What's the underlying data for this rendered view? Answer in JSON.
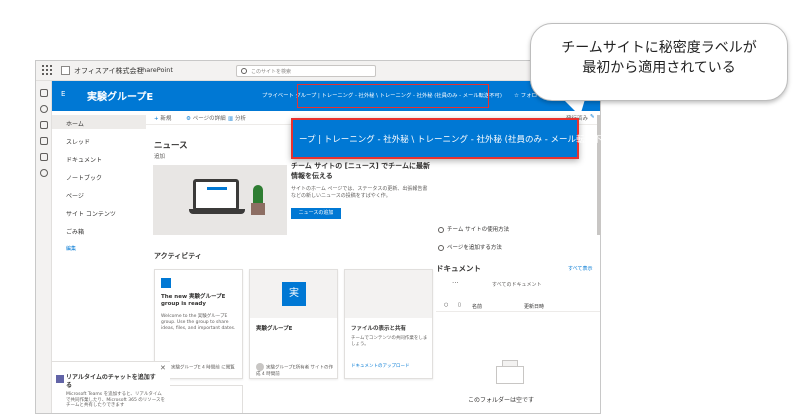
{
  "topbar": {
    "org": "オフィスアイ株式会社",
    "product": "SharePoint",
    "search_placeholder": "このサイトを検索"
  },
  "site": {
    "logo": "E",
    "name": "実験グループE",
    "label": "プライベート グループ | トレーニング - 社外秘 \\ トレーニング - 社外秘 (社員のみ - メール転送不可)",
    "follow": "☆ フォローしていません"
  },
  "nav": {
    "items": [
      "ホーム",
      "スレッド",
      "ドキュメント",
      "ノートブック",
      "ページ",
      "サイト コンテンツ",
      "ごみ箱"
    ],
    "edit": "編集"
  },
  "cmdbar": {
    "new": "新規",
    "page_details": "ページの詳細",
    "analytics": "分析",
    "published": "発行済み",
    "edit": "編集"
  },
  "news": {
    "title": "ニュース",
    "add": "追加",
    "headline": "チーム サイトの [ニュース] でチームに最新情報を伝える",
    "body": "サイトのホーム ページでは、ステータスの更新、出張報告書などの新しいニュースの投稿をすばやく作。",
    "button": "ニュースの追加"
  },
  "activity": {
    "title": "アクティビティ",
    "cards": [
      {
        "title": "The new 実験グループE group is ready",
        "desc": "Welcome to the 実験グループE group. Use the group to share ideas, files, and important dates.",
        "foot": "実験グループE\n4 時間前 に閲覧"
      },
      {
        "title": "実験グループE",
        "tile": "実",
        "foot": "実験グループE所有者\nサイトの作成 4 時間前"
      },
      {
        "title": "ファイルの表示と共有",
        "desc": "チームでコンテンツの共同作業をしましょう。",
        "foot": "ドキュメントのアップロード"
      }
    ]
  },
  "right": {
    "links": [
      "チーム サイトの使用方法",
      "ページを追加する方法"
    ],
    "docs_title": "ドキュメント",
    "docs_all": "すべて表示",
    "docs_filter": "すべてのドキュメント",
    "col_name": "名前",
    "col_modified": "更新日時",
    "empty": "このフォルダーは空です"
  },
  "teams": {
    "title": "リアルタイムのチャットを追加する",
    "desc": "Microsoft Teams を追加すると、リアルタイムで共同作業したり、Microsoft 365 のリソースをチームと共有したりできます"
  },
  "callout": {
    "line1": "チームサイトに秘密度ラベルが",
    "line2": "最初から適用されている"
  },
  "zoom": {
    "text": "ープ | トレーニング - 社外秘 \\ トレーニング - 社外秘 (社員のみ - メール転送不可)"
  },
  "colors": {
    "brand": "#0078d4",
    "highlight": "#e8312f"
  }
}
